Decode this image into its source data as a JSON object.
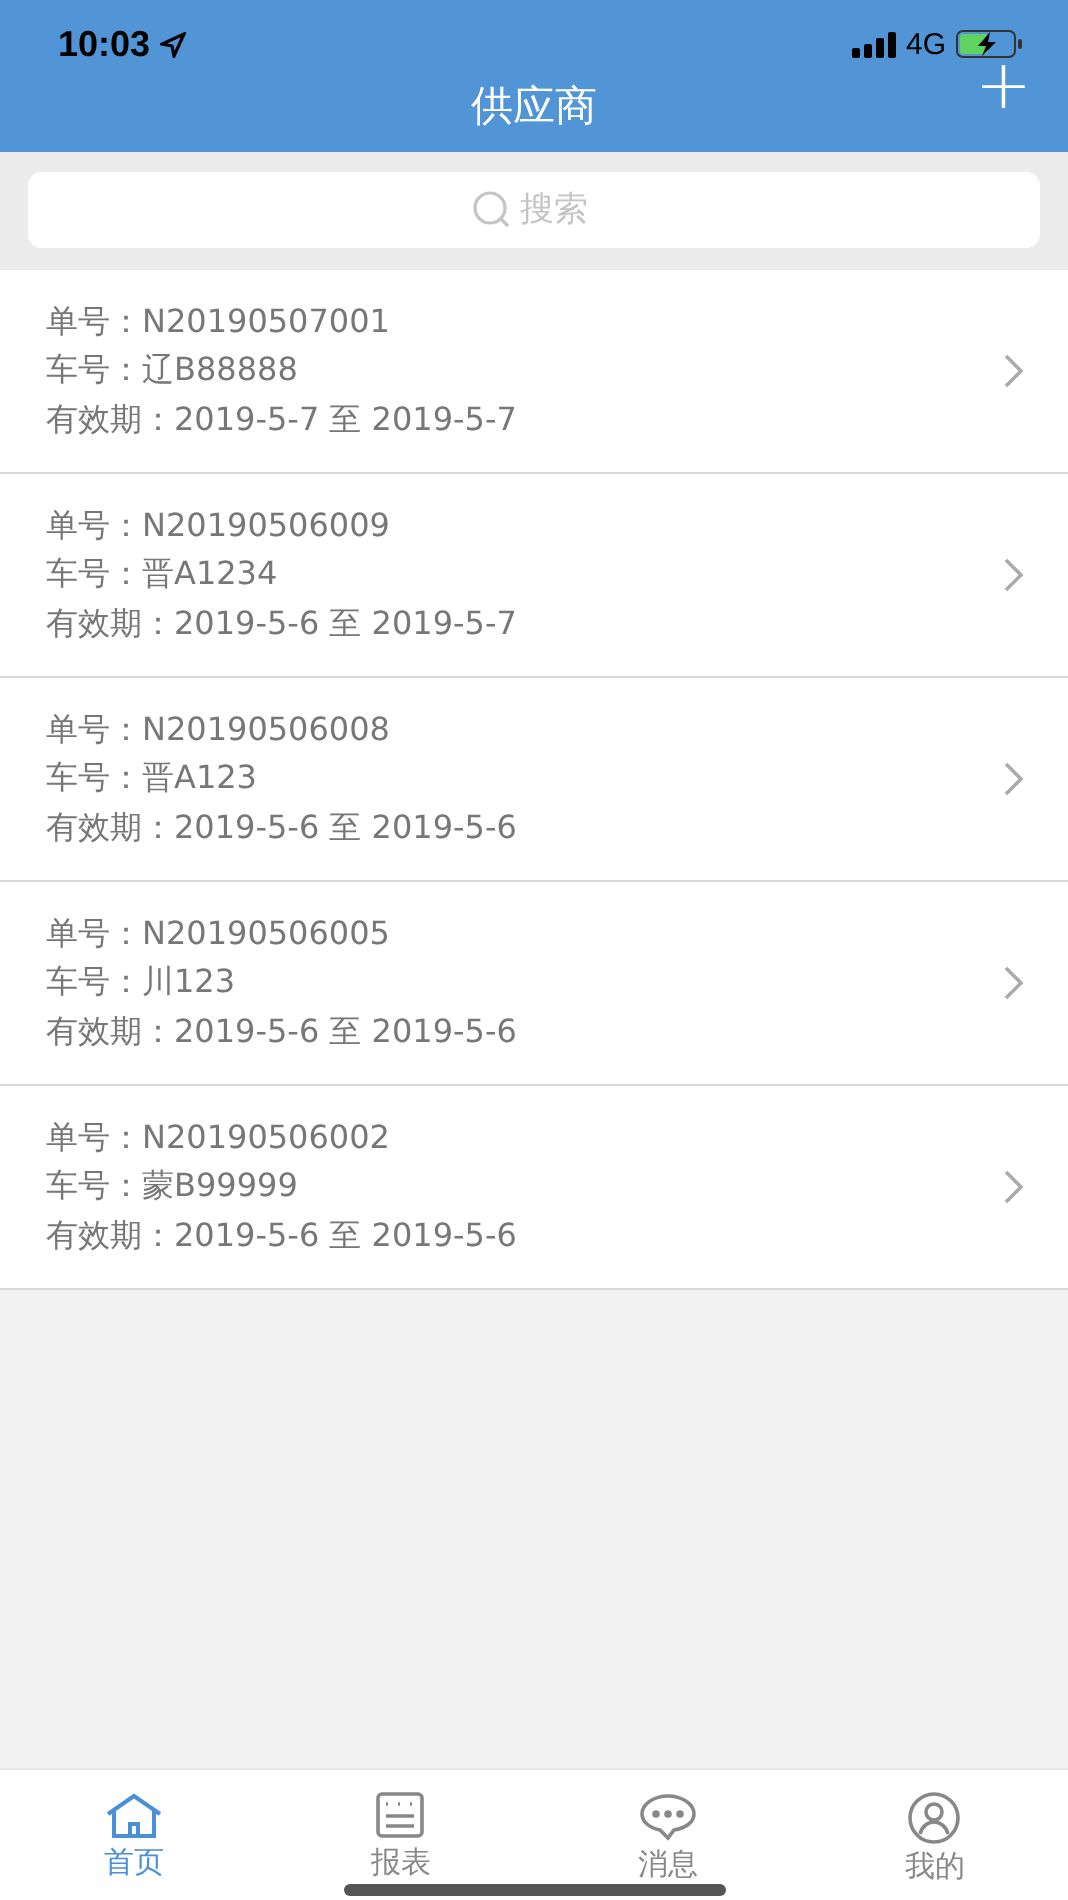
{
  "status_bar": {
    "time": "10:03",
    "network": "4G"
  },
  "nav": {
    "title": "供应商",
    "add_button": "+"
  },
  "search": {
    "placeholder": "搜索"
  },
  "orders": [
    {
      "lines": [
        "单号：N20190507001",
        "车号：辽B88888",
        "有效期：2019-5-7 至 2019-5-7"
      ]
    },
    {
      "lines": [
        "单号：N20190506009",
        "车号：晋A1234",
        "有效期：2019-5-6 至 2019-5-7"
      ]
    },
    {
      "lines": [
        "单号：N20190506008",
        "车号：晋A123",
        "有效期：2019-5-6 至 2019-5-6"
      ]
    },
    {
      "lines": [
        "单号：N20190506005",
        "车号：川123",
        "有效期：2019-5-6 至 2019-5-6"
      ]
    },
    {
      "lines": [
        "单号：N20190506002",
        "车号：蒙B99999",
        "有效期：2019-5-6 至 2019-5-6"
      ]
    }
  ],
  "tabs": [
    {
      "kind": "home",
      "label": "首页",
      "selected": true
    },
    {
      "kind": "report",
      "label": "报表",
      "selected": false
    },
    {
      "kind": "message",
      "label": "消息",
      "selected": false
    },
    {
      "kind": "profile",
      "label": "我的",
      "selected": false
    }
  ]
}
